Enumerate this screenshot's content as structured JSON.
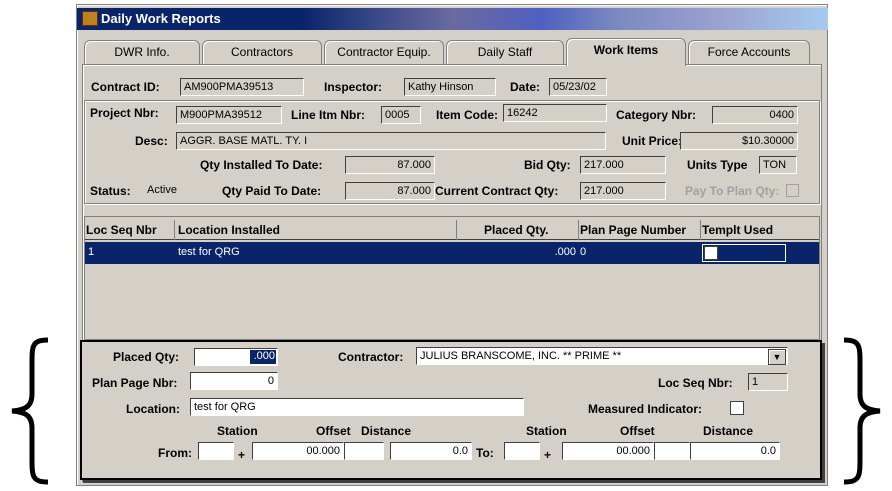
{
  "window": {
    "title": "Daily Work Reports"
  },
  "tabs": [
    {
      "label": "DWR Info."
    },
    {
      "label": "Contractors"
    },
    {
      "label": "Contractor Equip."
    },
    {
      "label": "Daily Staff"
    },
    {
      "label": "Work Items"
    },
    {
      "label": "Force Accounts"
    }
  ],
  "header": {
    "contract_id_label": "Contract ID:",
    "contract_id": "AM900PMA39513",
    "inspector_label": "Inspector:",
    "inspector": "Kathy Hinson",
    "date_label": "Date:",
    "date": "05/23/02"
  },
  "item": {
    "project_label": "Project Nbr:",
    "project": "M900PMA39512",
    "line_label": "Line Itm Nbr:",
    "line": "0005",
    "item_code_label": "Item Code:",
    "item_code": "16242",
    "category_label": "Category Nbr:",
    "category": "0400",
    "desc_label": "Desc:",
    "desc": "AGGR. BASE MATL. TY. I",
    "unit_price_label": "Unit Price:",
    "unit_price": "$10.30000",
    "qty_installed_label": "Qty Installed To Date:",
    "qty_installed": "87.000",
    "bid_qty_label": "Bid Qty:",
    "bid_qty": "217.000",
    "units_type_label": "Units Type",
    "units_type": "TON",
    "status_label": "Status:",
    "status": "Active",
    "qty_paid_label": "Qty Paid To Date:",
    "qty_paid": "87.000",
    "current_qty_label": "Current Contract Qty:",
    "current_qty": "217.000",
    "pay_to_plan_label": "Pay To Plan Qty:"
  },
  "grid": {
    "columns": [
      "Loc Seq Nbr",
      "Location Installed",
      "Placed Qty.",
      "Plan Page Number",
      "Templt Used"
    ],
    "rows": [
      {
        "seq": "1",
        "location": "test for QRG",
        "placed": ".000",
        "plan_page": "0"
      }
    ]
  },
  "detail": {
    "placed_qty_label": "Placed Qty:",
    "placed_qty": ".000",
    "contractor_label": "Contractor:",
    "contractor": "JULIUS BRANSCOME, INC.   ** PRIME **",
    "plan_page_label": "Plan Page Nbr:",
    "plan_page": "0",
    "loc_seq_label": "Loc Seq Nbr:",
    "loc_seq": "1",
    "location_label": "Location:",
    "location": "test for QRG",
    "measured_label": "Measured Indicator:",
    "station_label": "Station",
    "offset_label": "Offset",
    "distance_label": "Distance",
    "from_label": "From:",
    "to_label": "To:",
    "plus": "+",
    "from_offset": "00.000",
    "from_distance": "0.0",
    "to_offset": "00.000",
    "to_distance": "0.0"
  },
  "colors": {
    "titlebar": "#0a246a",
    "selection": "#0a246a",
    "panel": "#d4d0c8"
  }
}
